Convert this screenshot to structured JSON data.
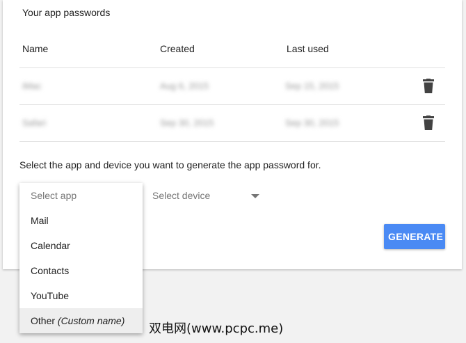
{
  "section": {
    "title": "Your app passwords"
  },
  "table": {
    "columns": [
      "Name",
      "Created",
      "Last used"
    ],
    "rows": [
      {
        "name": "iMac",
        "created": "Aug 6, 2015",
        "last_used": "Sep 15, 2015"
      },
      {
        "name": "Safari",
        "created": "Sep 30, 2015",
        "last_used": "Sep 30, 2015"
      }
    ]
  },
  "generator": {
    "instructions": "Select the app and device you want to generate the app password for.",
    "device_placeholder": "Select device",
    "generate_label": "GENERATE"
  },
  "app_dropdown": {
    "placeholder": "Select app",
    "items": [
      "Mail",
      "Calendar",
      "Contacts",
      "YouTube"
    ],
    "other_label": "Other",
    "other_hint": "(Custom name)"
  },
  "watermark": "双电网(www.pcpc.me)",
  "colors": {
    "accent": "#4a8af4",
    "trash": "#424242"
  },
  "icons": {
    "delete": "trash-icon",
    "dropdown": "caret-down-icon"
  }
}
